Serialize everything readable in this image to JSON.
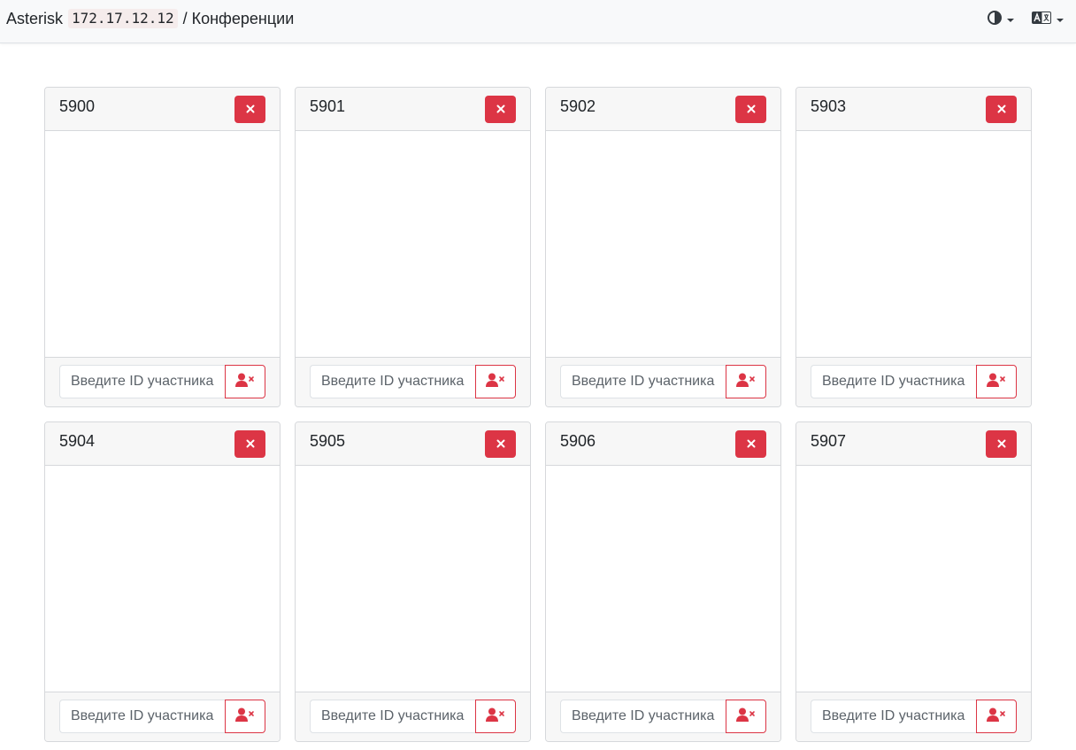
{
  "header": {
    "app_name": "Asterisk",
    "host": "172.17.12.12",
    "separator": "/",
    "page_title": "Конференции",
    "theme_icon": "contrast-icon",
    "language_icon": "translate-icon"
  },
  "colors": {
    "danger": "#dc3545",
    "navbar_bg": "#f8f9fa",
    "card_header_bg": "#f7f7f7"
  },
  "conferences": [
    {
      "id": "5900",
      "placeholder": "Введите ID участника"
    },
    {
      "id": "5901",
      "placeholder": "Введите ID участника"
    },
    {
      "id": "5902",
      "placeholder": "Введите ID участника"
    },
    {
      "id": "5903",
      "placeholder": "Введите ID участника"
    },
    {
      "id": "5904",
      "placeholder": "Введите ID участника"
    },
    {
      "id": "5905",
      "placeholder": "Введите ID участника"
    },
    {
      "id": "5906",
      "placeholder": "Введите ID участника"
    },
    {
      "id": "5907",
      "placeholder": "Введите ID участника"
    }
  ],
  "icons": {
    "close": "close-icon",
    "kick_participant": "user-remove-icon"
  }
}
